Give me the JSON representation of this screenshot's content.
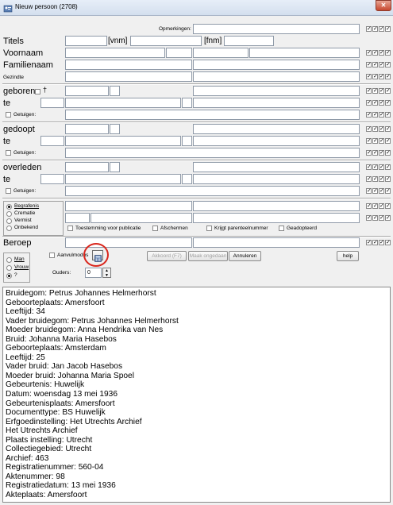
{
  "window": {
    "title": "Nieuw persoon (2708)"
  },
  "labels": {
    "opmerkingen": "Opmerkingen:",
    "titels": "Titels",
    "vnm": "[vnm]",
    "fnm": "[fnm]",
    "voornaam": "Voornaam",
    "familienaam": "Familienaam",
    "gezindte": "Gezindte",
    "geboren": "geboren",
    "dagger": "†",
    "te": "te",
    "getuigen": "Getuigen:",
    "gedoopt": "gedoopt",
    "overleden": "overleden",
    "beroep": "Beroep",
    "ouders": "Ouders:"
  },
  "burial_options": [
    {
      "label": "Begrafenis",
      "checked": true
    },
    {
      "label": "Crematie",
      "checked": false
    },
    {
      "label": "Vermist",
      "checked": false
    },
    {
      "label": "Onbekend",
      "checked": false
    }
  ],
  "flags": {
    "toestemming": "Toestemming voor publicatie",
    "afschermen": "Afschermen",
    "krijgt": "Krijgt parenteelnummer",
    "geadopteerd": "Geadopteerd"
  },
  "gender_options": [
    {
      "label": "Man",
      "checked": false
    },
    {
      "label": "Vrouw",
      "checked": false
    },
    {
      "label": "?",
      "checked": true
    }
  ],
  "aanvulmodus": "Aanvulmodus",
  "ouders_value": "0",
  "buttons": {
    "akkoord": "Akkoord (F7)",
    "maak_ongedaan": "Maak ongedaan",
    "annuleren": "Annuleren",
    "help": "help"
  },
  "colors": {
    "highlight_circle": "#d9261c",
    "titlebar": "#dbe5f1"
  },
  "memo_lines": [
    "Bruidegom: Petrus Johannes Helmerhorst",
    "Geboorteplaats: Amersfoort",
    "Leeftijd: 34",
    "Vader bruidegom: Petrus Johannes Helmerhorst",
    "Moeder bruidegom: Anna Hendrika van Nes",
    "Bruid: Johanna Maria Hasebos",
    "Geboorteplaats: Amsterdam",
    "Leeftijd: 25",
    "Vader bruid: Jan Jacob Hasebos",
    "Moeder bruid: Johanna Maria Spoel",
    "Gebeurtenis: Huwelijk",
    "Datum: woensdag 13 mei 1936",
    "Gebeurtenisplaats: Amersfoort",
    "Documenttype: BS Huwelijk",
    "Erfgoedinstelling: Het Utrechts Archief",
    "Het Utrechts Archief",
    "Plaats instelling: Utrecht",
    "Collectiegebied: Utrecht",
    "Archief: 463",
    "Registratienummer: 560-04",
    "Aktenummer: 98",
    "Registratiedatum: 13 mei 1936",
    "Akteplaats: Amersfoort"
  ]
}
